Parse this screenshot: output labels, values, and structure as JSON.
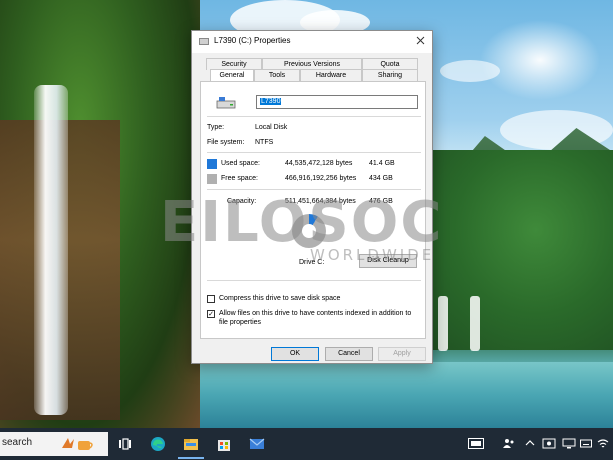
{
  "dialog": {
    "title": "L7390 (C:) Properties",
    "tabs_row1": [
      "Security",
      "Previous Versions",
      "Quota"
    ],
    "tabs_row2": [
      "General",
      "Tools",
      "Hardware",
      "Sharing"
    ],
    "active_tab": "General",
    "drive_name": "L7390",
    "type_label": "Type:",
    "type_value": "Local Disk",
    "fs_label": "File system:",
    "fs_value": "NTFS",
    "used_label": "Used space:",
    "used_bytes": "44,535,472,128 bytes",
    "used_gb": "41.4 GB",
    "free_label": "Free space:",
    "free_bytes": "466,916,192,256 bytes",
    "free_gb": "434 GB",
    "capacity_label": "Capacity:",
    "capacity_bytes": "511,451,664,384 bytes",
    "capacity_gb": "476 GB",
    "drive_label": "Drive C:",
    "disk_cleanup": "Disk Cleanup",
    "compress_label": "Compress this drive to save disk space",
    "compress_checked": false,
    "index_label_line1": "Allow files on this drive to have contents indexed in addition to",
    "index_label_line2": "file properties",
    "index_checked": true,
    "check_mark": "✓",
    "ok": "OK",
    "cancel": "Cancel",
    "apply": "Apply",
    "used_fraction": 0.087,
    "used_color": "#1f78d8",
    "free_color": "#b0b0b0"
  },
  "watermark": {
    "big": "EILOSOC",
    "small": "WORLDWIDE"
  },
  "taskbar": {
    "search_text": "search",
    "icons": [
      "task-view-icon",
      "edge-icon",
      "file-explorer-icon",
      "store-icon",
      "mail-icon"
    ],
    "tray_icons": [
      "meet-now-icon",
      "people-icon",
      "chevron-up-icon",
      "cloud-icon",
      "display-icon",
      "keyboard-icon",
      "wifi-icon"
    ]
  }
}
